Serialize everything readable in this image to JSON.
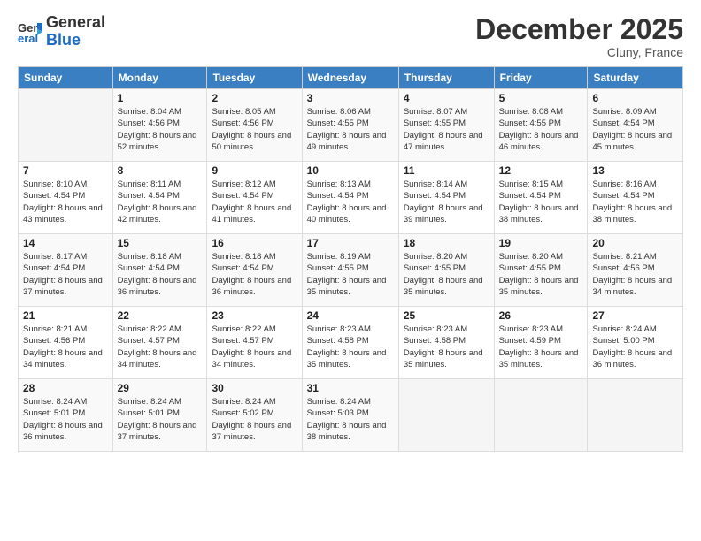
{
  "logo": {
    "general": "General",
    "blue": "Blue"
  },
  "header": {
    "month": "December 2025",
    "location": "Cluny, France"
  },
  "weekdays": [
    "Sunday",
    "Monday",
    "Tuesday",
    "Wednesday",
    "Thursday",
    "Friday",
    "Saturday"
  ],
  "weeks": [
    [
      {
        "day": "",
        "sunrise": "",
        "sunset": "",
        "daylight": ""
      },
      {
        "day": "1",
        "sunrise": "8:04 AM",
        "sunset": "4:56 PM",
        "daylight": "8 hours and 52 minutes."
      },
      {
        "day": "2",
        "sunrise": "8:05 AM",
        "sunset": "4:56 PM",
        "daylight": "8 hours and 50 minutes."
      },
      {
        "day": "3",
        "sunrise": "8:06 AM",
        "sunset": "4:55 PM",
        "daylight": "8 hours and 49 minutes."
      },
      {
        "day": "4",
        "sunrise": "8:07 AM",
        "sunset": "4:55 PM",
        "daylight": "8 hours and 47 minutes."
      },
      {
        "day": "5",
        "sunrise": "8:08 AM",
        "sunset": "4:55 PM",
        "daylight": "8 hours and 46 minutes."
      },
      {
        "day": "6",
        "sunrise": "8:09 AM",
        "sunset": "4:54 PM",
        "daylight": "8 hours and 45 minutes."
      }
    ],
    [
      {
        "day": "7",
        "sunrise": "8:10 AM",
        "sunset": "4:54 PM",
        "daylight": "8 hours and 43 minutes."
      },
      {
        "day": "8",
        "sunrise": "8:11 AM",
        "sunset": "4:54 PM",
        "daylight": "8 hours and 42 minutes."
      },
      {
        "day": "9",
        "sunrise": "8:12 AM",
        "sunset": "4:54 PM",
        "daylight": "8 hours and 41 minutes."
      },
      {
        "day": "10",
        "sunrise": "8:13 AM",
        "sunset": "4:54 PM",
        "daylight": "8 hours and 40 minutes."
      },
      {
        "day": "11",
        "sunrise": "8:14 AM",
        "sunset": "4:54 PM",
        "daylight": "8 hours and 39 minutes."
      },
      {
        "day": "12",
        "sunrise": "8:15 AM",
        "sunset": "4:54 PM",
        "daylight": "8 hours and 38 minutes."
      },
      {
        "day": "13",
        "sunrise": "8:16 AM",
        "sunset": "4:54 PM",
        "daylight": "8 hours and 38 minutes."
      }
    ],
    [
      {
        "day": "14",
        "sunrise": "8:17 AM",
        "sunset": "4:54 PM",
        "daylight": "8 hours and 37 minutes."
      },
      {
        "day": "15",
        "sunrise": "8:18 AM",
        "sunset": "4:54 PM",
        "daylight": "8 hours and 36 minutes."
      },
      {
        "day": "16",
        "sunrise": "8:18 AM",
        "sunset": "4:54 PM",
        "daylight": "8 hours and 36 minutes."
      },
      {
        "day": "17",
        "sunrise": "8:19 AM",
        "sunset": "4:55 PM",
        "daylight": "8 hours and 35 minutes."
      },
      {
        "day": "18",
        "sunrise": "8:20 AM",
        "sunset": "4:55 PM",
        "daylight": "8 hours and 35 minutes."
      },
      {
        "day": "19",
        "sunrise": "8:20 AM",
        "sunset": "4:55 PM",
        "daylight": "8 hours and 35 minutes."
      },
      {
        "day": "20",
        "sunrise": "8:21 AM",
        "sunset": "4:56 PM",
        "daylight": "8 hours and 34 minutes."
      }
    ],
    [
      {
        "day": "21",
        "sunrise": "8:21 AM",
        "sunset": "4:56 PM",
        "daylight": "8 hours and 34 minutes."
      },
      {
        "day": "22",
        "sunrise": "8:22 AM",
        "sunset": "4:57 PM",
        "daylight": "8 hours and 34 minutes."
      },
      {
        "day": "23",
        "sunrise": "8:22 AM",
        "sunset": "4:57 PM",
        "daylight": "8 hours and 34 minutes."
      },
      {
        "day": "24",
        "sunrise": "8:23 AM",
        "sunset": "4:58 PM",
        "daylight": "8 hours and 35 minutes."
      },
      {
        "day": "25",
        "sunrise": "8:23 AM",
        "sunset": "4:58 PM",
        "daylight": "8 hours and 35 minutes."
      },
      {
        "day": "26",
        "sunrise": "8:23 AM",
        "sunset": "4:59 PM",
        "daylight": "8 hours and 35 minutes."
      },
      {
        "day": "27",
        "sunrise": "8:24 AM",
        "sunset": "5:00 PM",
        "daylight": "8 hours and 36 minutes."
      }
    ],
    [
      {
        "day": "28",
        "sunrise": "8:24 AM",
        "sunset": "5:01 PM",
        "daylight": "8 hours and 36 minutes."
      },
      {
        "day": "29",
        "sunrise": "8:24 AM",
        "sunset": "5:01 PM",
        "daylight": "8 hours and 37 minutes."
      },
      {
        "day": "30",
        "sunrise": "8:24 AM",
        "sunset": "5:02 PM",
        "daylight": "8 hours and 37 minutes."
      },
      {
        "day": "31",
        "sunrise": "8:24 AM",
        "sunset": "5:03 PM",
        "daylight": "8 hours and 38 minutes."
      },
      {
        "day": "",
        "sunrise": "",
        "sunset": "",
        "daylight": ""
      },
      {
        "day": "",
        "sunrise": "",
        "sunset": "",
        "daylight": ""
      },
      {
        "day": "",
        "sunrise": "",
        "sunset": "",
        "daylight": ""
      }
    ]
  ],
  "labels": {
    "sunrise": "Sunrise:",
    "sunset": "Sunset:",
    "daylight": "Daylight:"
  }
}
